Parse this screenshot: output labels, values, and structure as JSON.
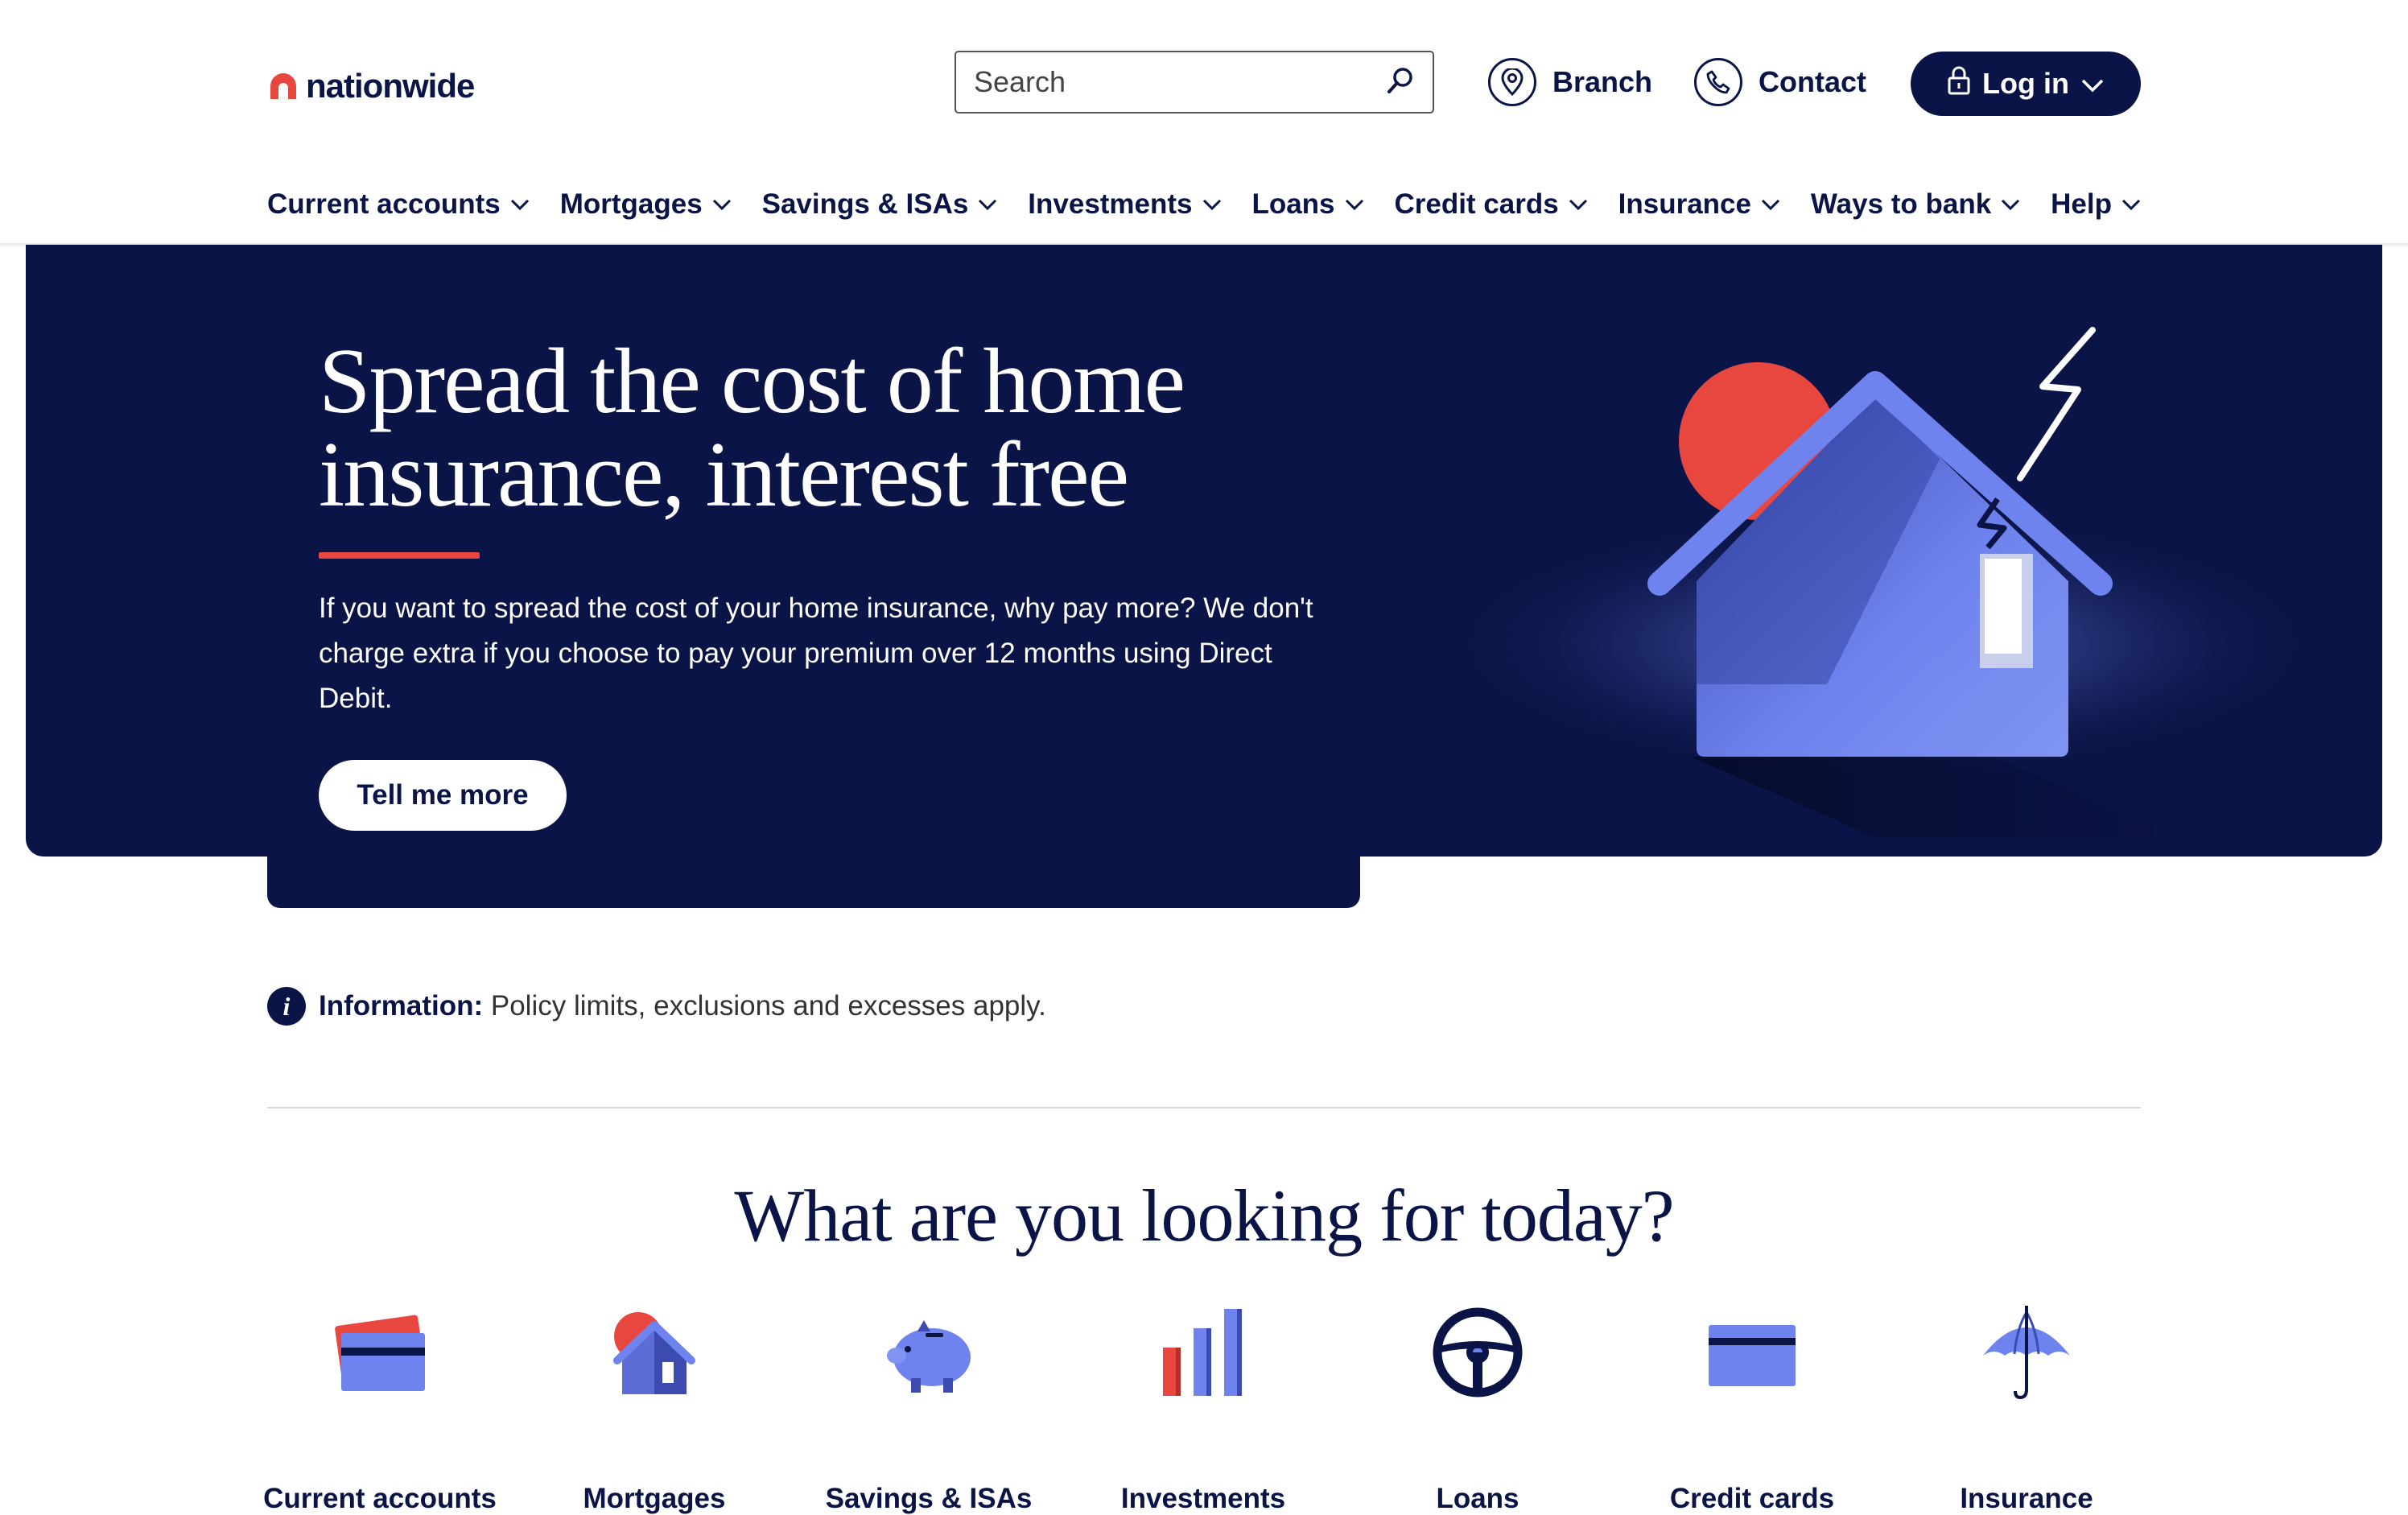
{
  "header": {
    "logo_text": "nationwide",
    "search": {
      "placeholder": "Search",
      "value": ""
    },
    "branch_label": "Branch",
    "contact_label": "Contact",
    "login_label": "Log in"
  },
  "nav": {
    "items": [
      {
        "label": "Current accounts"
      },
      {
        "label": "Mortgages"
      },
      {
        "label": "Savings & ISAs"
      },
      {
        "label": "Investments"
      },
      {
        "label": "Loans"
      },
      {
        "label": "Credit cards"
      },
      {
        "label": "Insurance"
      },
      {
        "label": "Ways to bank"
      },
      {
        "label": "Help"
      }
    ]
  },
  "hero": {
    "title_line1": "Spread the cost of home",
    "title_line2": "insurance, interest free",
    "body": "If you want to spread the cost of your home insurance, why pay more? We don't charge extra if you choose to pay your premium over 12 months using Direct Debit.",
    "cta_label": "Tell me more",
    "illustration": "house-with-lightning-illustration"
  },
  "info": {
    "label": "Information:",
    "text": "Policy limits, exclusions and excesses apply."
  },
  "looking_for": {
    "title": "What are you looking for today?",
    "tiles": [
      {
        "label": "Current accounts",
        "icon": "bank-cards-icon"
      },
      {
        "label": "Mortgages",
        "icon": "house-icon"
      },
      {
        "label": "Savings & ISAs",
        "icon": "piggy-bank-icon"
      },
      {
        "label": "Investments",
        "icon": "bar-chart-icon"
      },
      {
        "label": "Loans",
        "icon": "steering-wheel-icon"
      },
      {
        "label": "Credit cards",
        "icon": "credit-card-icon"
      },
      {
        "label": "Insurance",
        "icon": "umbrella-icon"
      }
    ]
  },
  "colors": {
    "navy": "#0a1446",
    "brand_red": "#e8473f",
    "accent_blue": "#6f83ee",
    "divider": "#d7d7dc"
  }
}
